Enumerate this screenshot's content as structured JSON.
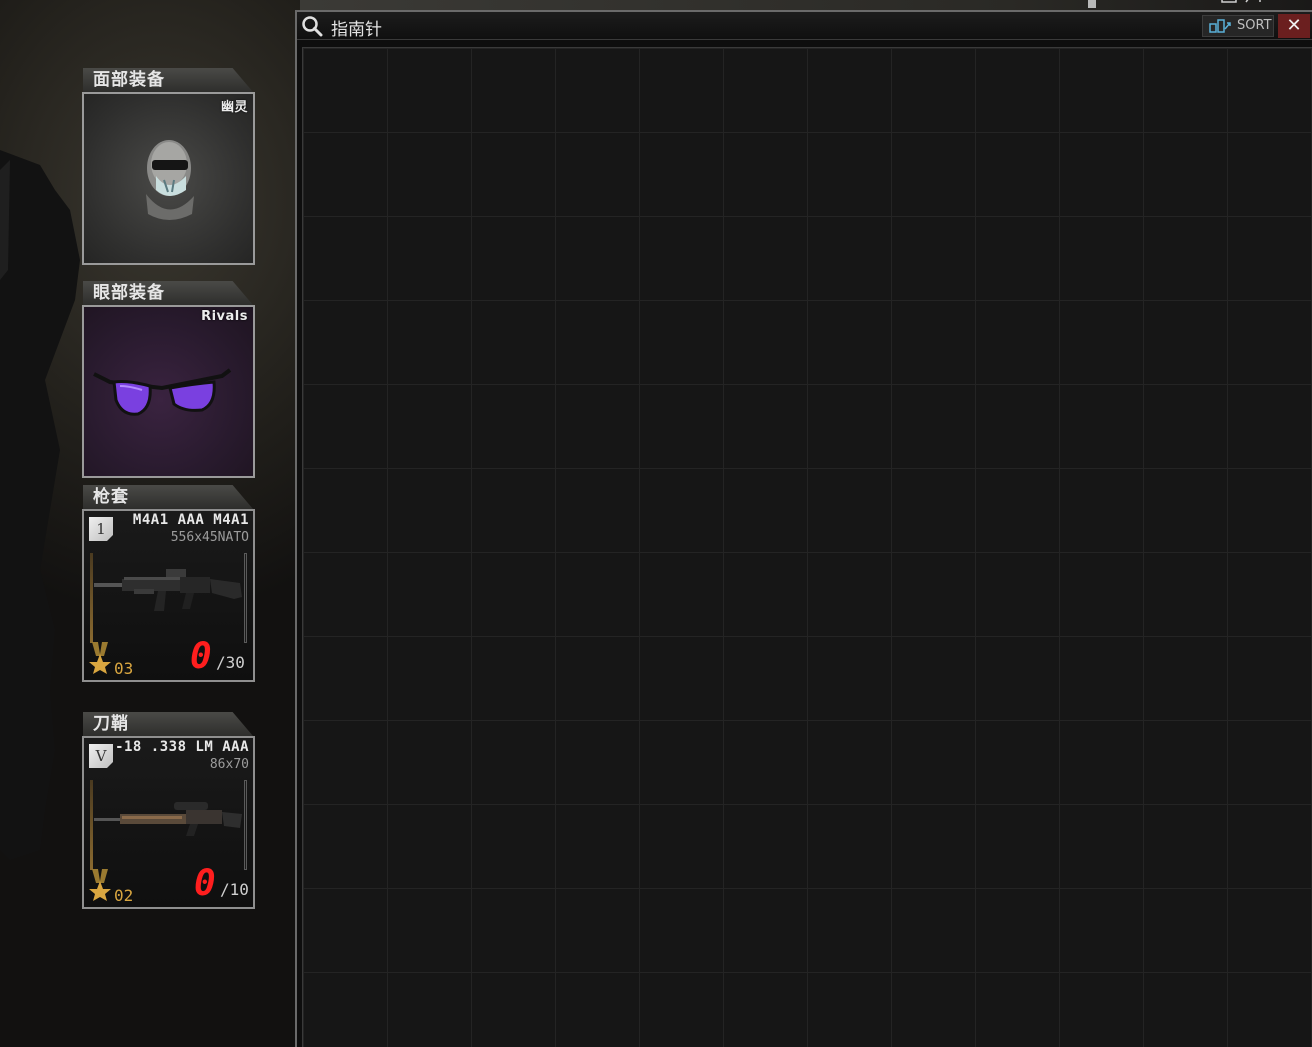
{
  "container": {
    "title": "指南针",
    "sort_label": "SORT",
    "close_label": "✕"
  },
  "slots": {
    "face": {
      "header": "面部装备",
      "item_name": "幽灵",
      "icon": "balaclava-icon"
    },
    "eye": {
      "header": "眼部装备",
      "item_name": "Rivals",
      "icon": "glasses-icon"
    },
    "holster": {
      "header": "枪套",
      "badge": "1",
      "weapon_name": "M4A1 AAA M4A1",
      "caliber": "556x45NATO",
      "rank": "03",
      "ammo_current": "0",
      "ammo_max": "/30",
      "icon": "rifle-icon"
    },
    "scabbard": {
      "header": "刀鞘",
      "badge": "V",
      "weapon_name": "-18 .338 LM AAA",
      "caliber": "86x70",
      "rank": "02",
      "ammo_current": "0",
      "ammo_max": "/10",
      "icon": "sniper-rifle-icon"
    }
  },
  "colors": {
    "ammo_empty": "#ff1e1e",
    "rank": "#d9a640",
    "close_button": "#6b1f1f"
  }
}
